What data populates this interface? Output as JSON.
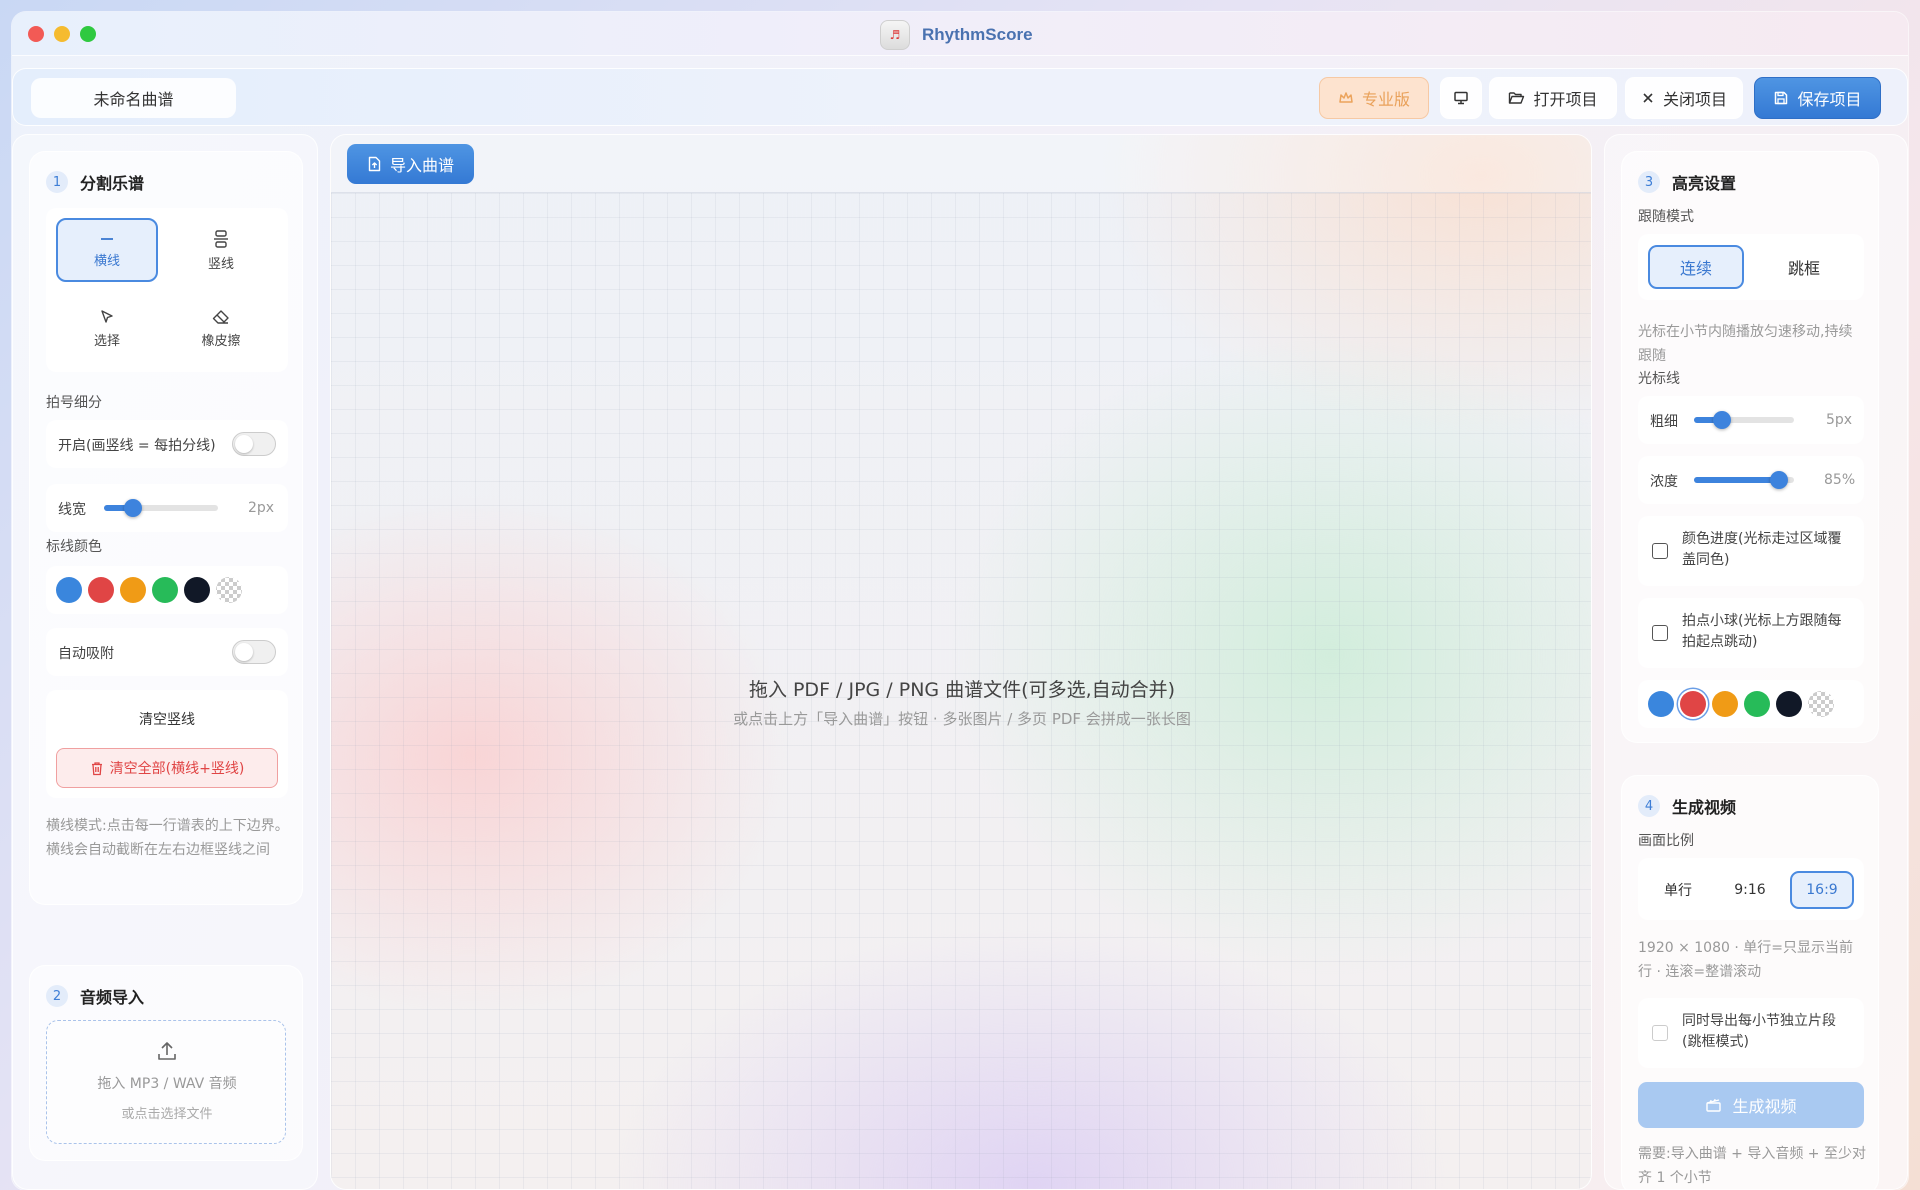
{
  "app": {
    "title": "RhythmScore",
    "logo_glyph": "♬"
  },
  "toolbar": {
    "project_name": "未命名曲谱",
    "pro_label": "专业版",
    "open_label": "打开项目",
    "close_label": "关闭项目",
    "save_label": "保存项目"
  },
  "segment": {
    "number": "1",
    "title": "分割乐谱",
    "tools": [
      {
        "label": "横线",
        "icon": "horizontal-line-icon",
        "active": true
      },
      {
        "label": "竖线",
        "icon": "vertical-split-icon",
        "active": false
      },
      {
        "label": "选择",
        "icon": "cursor-icon",
        "active": false
      },
      {
        "label": "橡皮擦",
        "icon": "eraser-icon",
        "active": false
      }
    ],
    "beat_label": "拍号细分",
    "beat_toggle_label": "开启(画竖线 = 每拍分线)",
    "beat_toggle_on": false,
    "line_width_label": "线宽",
    "line_width_value": "2px",
    "line_width_fraction": 0.25,
    "line_color_label": "标线颜色",
    "colors": [
      "#3a86dd",
      "#e04545",
      "#f09b16",
      "#27bb59",
      "#111827",
      "transparent"
    ],
    "snap_label": "自动吸附",
    "snap_on": false,
    "clear_vertical_label": "清空竖线",
    "clear_all_label": "清空全部(横线+竖线)",
    "help": "横线模式:点击每一行谱表的上下边界。横线会自动截断在左右边框竖线之间"
  },
  "audio": {
    "number": "2",
    "title": "音频导入",
    "drop_label": "拖入 MP3 / WAV 音频",
    "drop_sub": "或点击选择文件"
  },
  "canvas": {
    "import_label": "导入曲谱",
    "drop_main": "拖入 PDF / JPG / PNG 曲谱文件(可多选,自动合并)",
    "drop_sub": "或点击上方「导入曲谱」按钮 · 多张图片 / 多页 PDF 会拼成一张长图"
  },
  "highlight": {
    "number": "3",
    "title": "高亮设置",
    "follow_label": "跟随模式",
    "modes": [
      {
        "label": "连续",
        "active": true
      },
      {
        "label": "跳框",
        "active": false
      }
    ],
    "mode_help": "光标在小节内随播放匀速移动,持续跟随",
    "cursor_label": "光标线",
    "thickness_label": "粗细",
    "thickness_value": "5px",
    "thickness_fraction": 0.28,
    "opacity_label": "浓度",
    "opacity_value": "85%",
    "opacity_fraction": 0.85,
    "color_progress_label": "颜色进度(光标走过区域覆盖同色)",
    "beat_ball_label": "拍点小球(光标上方跟随每拍起点跳动)",
    "colors": [
      "#3a86dd",
      "#e04545",
      "#f09b16",
      "#27bb59",
      "#111827",
      "transparent"
    ]
  },
  "video": {
    "number": "4",
    "title": "生成视频",
    "ratio_label": "画面比例",
    "ratios": [
      {
        "label": "单行",
        "active": false
      },
      {
        "label": "9:16",
        "active": false
      },
      {
        "label": "16:9",
        "active": true
      }
    ],
    "ratio_help": "1920 × 1080 · 单行=只显示当前行 · 连滚=整谱滚动",
    "export_segments_label": "同时导出每小节独立片段(跳框模式)",
    "generate_label": "生成视频",
    "requirement": "需要:导入曲谱 + 导入音频 + 至少对齐 1 个小节"
  }
}
